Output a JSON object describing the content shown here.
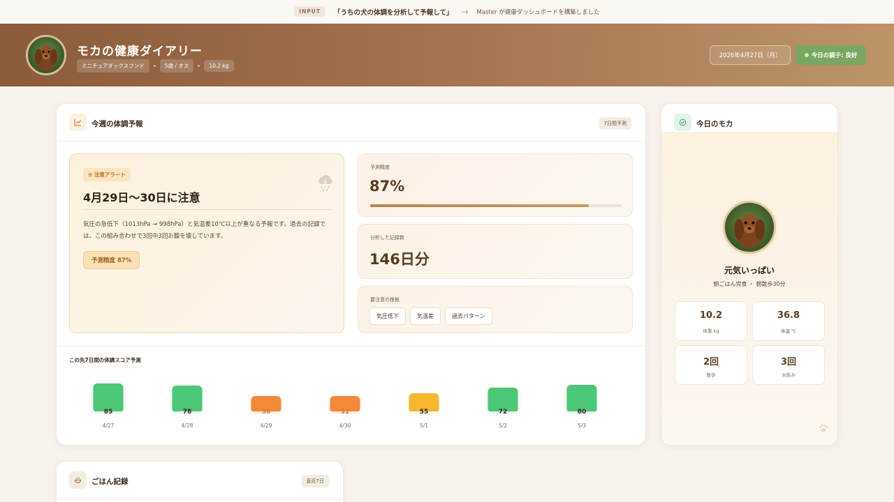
{
  "topbar": {
    "badge": "INPUT",
    "quote": "「うちの犬の体調を分析して予報して」",
    "arrow": "→",
    "result": "Master が健康ダッシュボードを構築しました"
  },
  "header": {
    "title": "モカの健康ダイアリー",
    "tags": [
      "ミニチュアダックスフンド",
      "5歳 / オス",
      "10.2 kg"
    ],
    "date": "2026年4月27日（月）",
    "status": "今日の調子: 良好"
  },
  "forecast_card": {
    "icon": "chart-icon",
    "title": "今週の体調予報",
    "badge": "7日間予測",
    "alert": {
      "badge": "≡ 注意アラート",
      "title": "4月29日～30日に注意",
      "text": "気圧の急低下（1013hPa → 998hPa）と気温差10℃以上が重なる予報です。過去の記録では、この組み合わせで3回中3回お腹を壊しています。",
      "chip": "予測精度 87%"
    },
    "accuracy": {
      "label": "予測精度",
      "value": "87%",
      "percent": 87
    },
    "records": {
      "label": "分析した記録数",
      "value": "146日分"
    },
    "factors": {
      "label": "要注意の根拠",
      "items": [
        "気圧低下",
        "気温差",
        "過去パターン"
      ]
    },
    "forecast_title": "この先7日間の体調スコア予測"
  },
  "chart_data": {
    "type": "bar",
    "categories": [
      "4/27",
      "4/28",
      "4/29",
      "4/30",
      "5/1",
      "5/2",
      "5/3"
    ],
    "values": [
      85,
      78,
      38,
      32,
      55,
      72,
      80
    ],
    "colors": [
      "#4cc777",
      "#4cc777",
      "#f28a3a",
      "#f28a3a",
      "#f5b72e",
      "#4cc777",
      "#4cc777"
    ]
  },
  "today_card": {
    "icon": "check-circle-icon",
    "title": "今日のモカ",
    "status": "元気いっぱい",
    "sub": "朝ごはん完食 ・ 朝散歩30分",
    "metrics": [
      {
        "value": "10.2",
        "label": "体重 kg"
      },
      {
        "value": "36.8",
        "label": "体温 ℃"
      },
      {
        "value": "2回",
        "label": "散歩"
      },
      {
        "value": "3回",
        "label": "水飲み"
      }
    ]
  },
  "meal_card": {
    "icon": "bowl-icon",
    "title": "ごはん記録",
    "badge": "直近7日"
  }
}
